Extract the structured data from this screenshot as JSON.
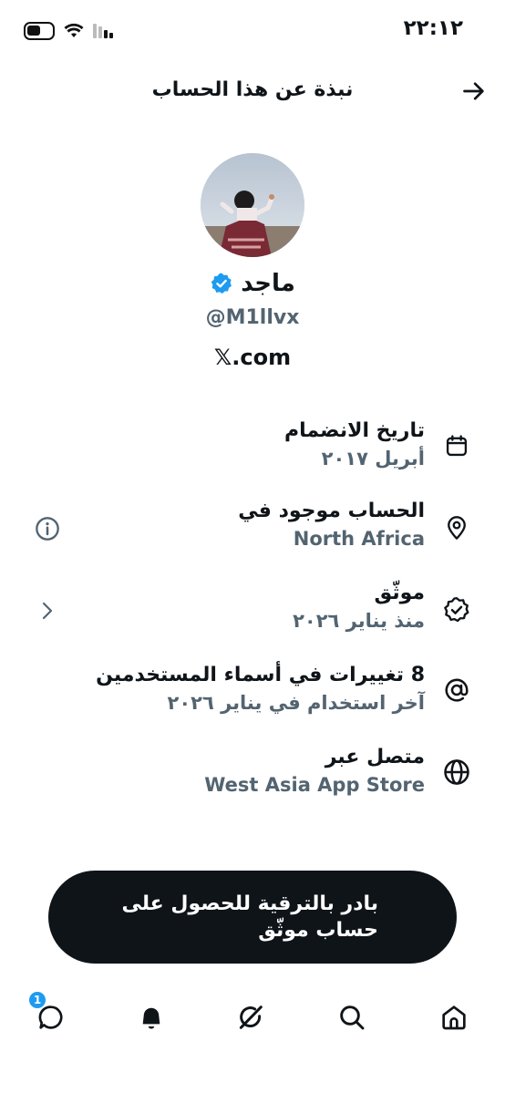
{
  "status_bar": {
    "time": "٢٢:١٢"
  },
  "header": {
    "title": "نبذة عن هذا الحساب"
  },
  "profile": {
    "name": "ماجد",
    "handle": "@M1llvx",
    "site": "𝕏.com"
  },
  "rows": [
    {
      "title": "تاريخ الانضمام",
      "subtitle": "أبريل ٢٠١٧",
      "icon": "calendar-icon"
    },
    {
      "title": "الحساب موجود في",
      "subtitle": "North Africa",
      "icon": "location-pin-icon",
      "side_icon": "info-icon"
    },
    {
      "title": "موثّق",
      "subtitle": "منذ يناير ٢٠٢٦",
      "icon": "verified-badge-icon",
      "side_icon": "chevron-right-icon"
    },
    {
      "title": "8 تغييرات في أسماء المستخدمين",
      "subtitle": "آخر استخدام في يناير ٢٠٢٦",
      "icon": "at-sign-icon"
    },
    {
      "title": "متصل عبر",
      "subtitle": "West Asia App Store",
      "icon": "globe-icon"
    }
  ],
  "cta": {
    "label": "بادر بالترقية للحصول على حساب موثّق"
  },
  "tabbar": {
    "items": [
      "messages-icon",
      "notifications-icon",
      "grok-icon",
      "search-icon",
      "home-icon"
    ],
    "messages_badge": "1"
  },
  "colors": {
    "accent": "#1d9bf0",
    "text": "#0f1419",
    "secondary": "#536471",
    "button": "#0f1419"
  }
}
